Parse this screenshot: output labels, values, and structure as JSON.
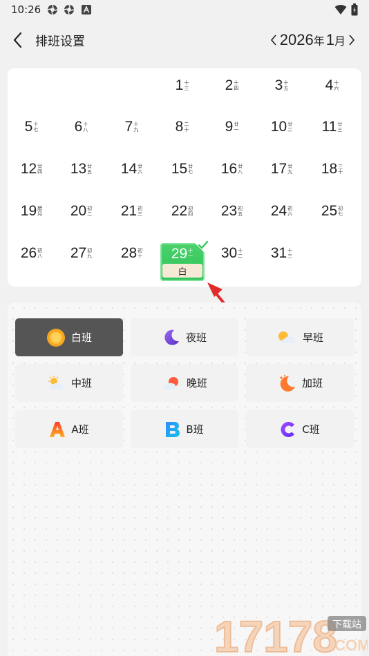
{
  "status_bar": {
    "time": "10:26"
  },
  "header": {
    "title": "排班设置",
    "year": "2026",
    "year_unit": "年",
    "month": "1",
    "month_unit": "月"
  },
  "calendar": {
    "days": [
      {
        "day": "1",
        "lunar": "十三"
      },
      {
        "day": "2",
        "lunar": "十四"
      },
      {
        "day": "3",
        "lunar": "十五"
      },
      {
        "day": "4",
        "lunar": "十六"
      },
      {
        "day": "5",
        "lunar": "十七"
      },
      {
        "day": "6",
        "lunar": "十八"
      },
      {
        "day": "7",
        "lunar": "十九"
      },
      {
        "day": "8",
        "lunar": "二十"
      },
      {
        "day": "9",
        "lunar": "廿一"
      },
      {
        "day": "10",
        "lunar": "廿二"
      },
      {
        "day": "11",
        "lunar": "廿三"
      },
      {
        "day": "12",
        "lunar": "廿四"
      },
      {
        "day": "13",
        "lunar": "廿五"
      },
      {
        "day": "14",
        "lunar": "廿六"
      },
      {
        "day": "15",
        "lunar": "廿七"
      },
      {
        "day": "16",
        "lunar": "廿八"
      },
      {
        "day": "17",
        "lunar": "廿九"
      },
      {
        "day": "18",
        "lunar": "三十"
      },
      {
        "day": "19",
        "lunar": "腊月"
      },
      {
        "day": "20",
        "lunar": "初二"
      },
      {
        "day": "21",
        "lunar": "初三"
      },
      {
        "day": "22",
        "lunar": "初四"
      },
      {
        "day": "23",
        "lunar": "初五"
      },
      {
        "day": "24",
        "lunar": "初六"
      },
      {
        "day": "25",
        "lunar": "初七"
      },
      {
        "day": "26",
        "lunar": "初八"
      },
      {
        "day": "27",
        "lunar": "初九"
      },
      {
        "day": "28",
        "lunar": "初十"
      },
      {
        "day": "29",
        "lunar": "十一"
      },
      {
        "day": "30",
        "lunar": "十二"
      },
      {
        "day": "31",
        "lunar": "十三"
      }
    ],
    "selected_tag": "白"
  },
  "shifts": [
    {
      "label": "白班",
      "icon": "sun-icon"
    },
    {
      "label": "夜班",
      "icon": "moon-icon"
    },
    {
      "label": "早班",
      "icon": "sun-cloud-icon"
    },
    {
      "label": "中班",
      "icon": "sun-cloud-icon"
    },
    {
      "label": "晚班",
      "icon": "sunset-cloud-icon"
    },
    {
      "label": "加班",
      "icon": "moon-stars-icon"
    },
    {
      "label": "A班",
      "icon": "letter-a-icon"
    },
    {
      "label": "B班",
      "icon": "letter-b-icon"
    },
    {
      "label": "C班",
      "icon": "letter-c-icon"
    }
  ],
  "watermark": {
    "number": "17178",
    "tag": "下载站",
    "domain": ".COM"
  },
  "colors": {
    "selected_green": "#33c75a",
    "active_shift": "#555555",
    "arrow_red": "#e02b2b"
  }
}
